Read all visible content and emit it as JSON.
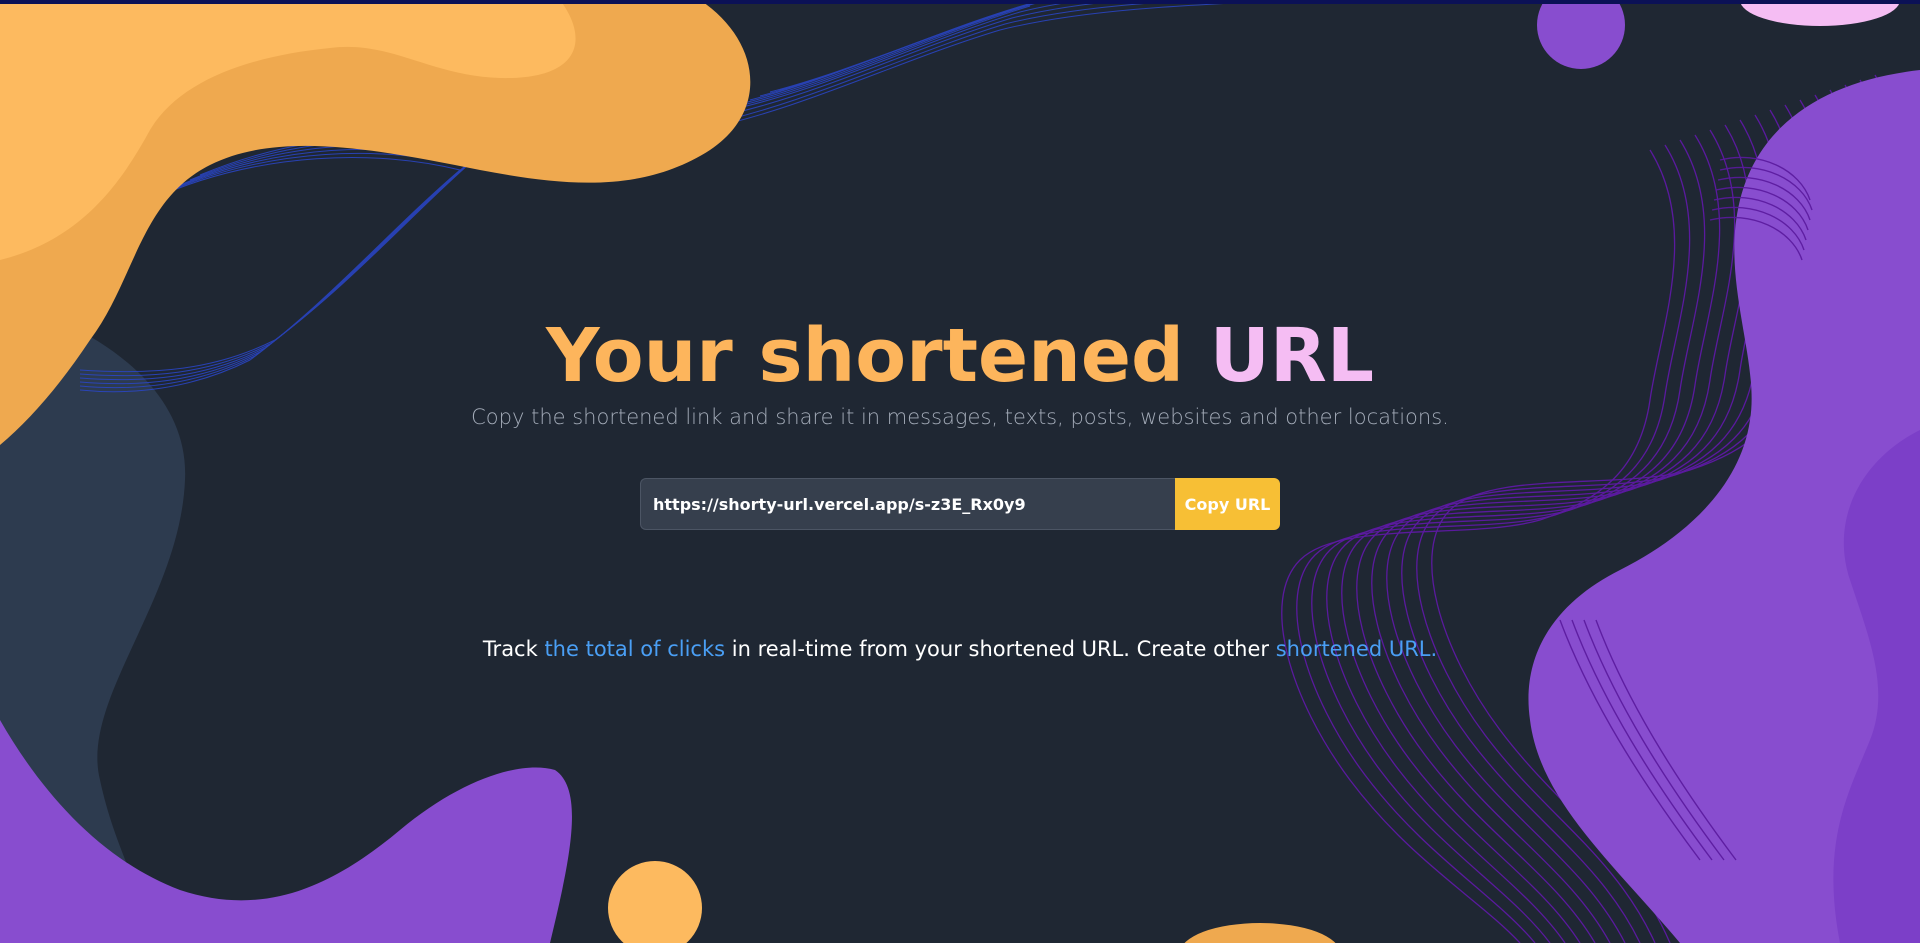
{
  "page": {
    "title_part1": "Your shortened ",
    "title_part2": "URL",
    "subtitle": "Copy the shortened link and share it in messages, texts, posts, websites and other locations."
  },
  "url_box": {
    "value": "https://shorty-url.vercel.app/s-z3E_Rx0y9",
    "copy_label": "Copy URL"
  },
  "footer_text": {
    "prefix": "Track ",
    "clicks_link": "the total of clicks",
    "middle": " in real-time from your shortened URL. Create other ",
    "shorten_link": "shortened URL."
  },
  "colors": {
    "background": "#1f2733",
    "title_orange": "#fdb55c",
    "title_pink": "#f5bdf3",
    "copy_button": "#f7bf35",
    "link_blue": "#4a9ff5",
    "blob_orange": "#efa94f",
    "blob_purple": "#884dcf"
  }
}
